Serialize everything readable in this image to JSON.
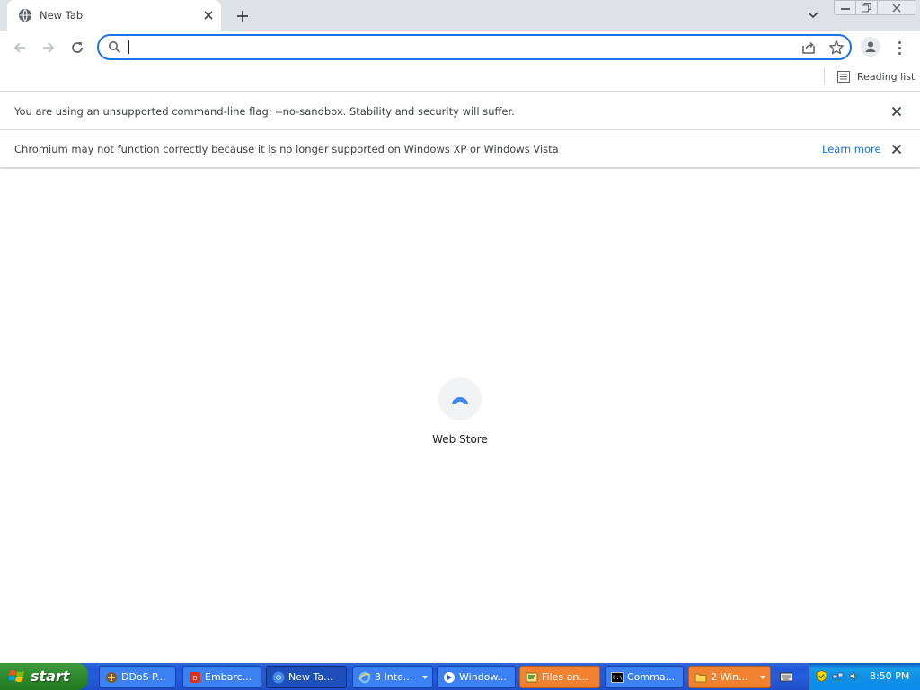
{
  "browser": {
    "tab": {
      "title": "New Tab"
    },
    "omnibox": {
      "value": "",
      "placeholder": ""
    },
    "bookmarks": {
      "reading_list": "Reading list"
    }
  },
  "infobars": [
    {
      "message": "You are using an unsupported command-line flag: --no-sandbox. Stability and security will suffer."
    },
    {
      "message": "Chromium may not function correctly because it is no longer supported on Windows XP or Windows Vista",
      "link": "Learn more"
    }
  ],
  "content": {
    "tiles": [
      {
        "label": "Web Store"
      }
    ]
  },
  "taskbar": {
    "start_label": "start",
    "tasks": [
      {
        "label": "DDoS P...",
        "icon": "ddos-app-icon"
      },
      {
        "label": "Embarc...",
        "icon": "embarcadero-icon"
      },
      {
        "label": "New Ta...",
        "icon": "chromium-icon",
        "active": true
      },
      {
        "label": "3 Inte...",
        "icon": "internet-explorer-icon"
      },
      {
        "label": "Window...",
        "icon": "media-player-icon"
      },
      {
        "label": "Files an...",
        "icon": "files-icon"
      },
      {
        "label": "Comma...",
        "icon": "command-prompt-icon"
      },
      {
        "label": "2 Win...",
        "icon": "folder-icon"
      }
    ],
    "clock": "8:50 PM"
  },
  "colors": {
    "accent": "#1a73e8",
    "tabstrip": "#dee1e6",
    "taskbar_blue": "#245edb",
    "start_green": "#2f8a2f"
  }
}
